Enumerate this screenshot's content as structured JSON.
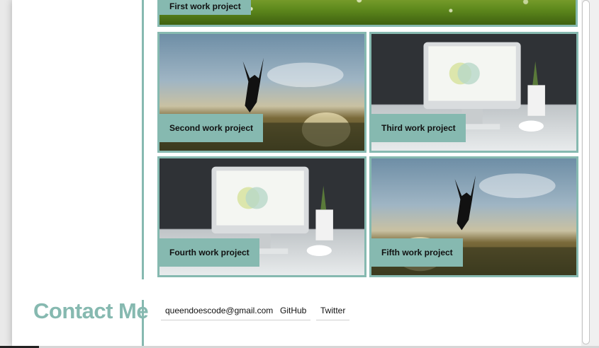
{
  "projects": [
    {
      "label": "First work project",
      "art": "meadow"
    },
    {
      "label": "Second work project",
      "art": "jumping-person"
    },
    {
      "label": "Third work project",
      "art": "desk-monitor"
    },
    {
      "label": "Fourth work project",
      "art": "desk-monitor"
    },
    {
      "label": "Fifth work project",
      "art": "jumping-person"
    }
  ],
  "contact": {
    "title": "Contact Me",
    "email": "queendoescode@gmail.com",
    "github": "GitHub",
    "twitter": "Twitter"
  },
  "colors": {
    "accent": "#86b9b0",
    "label_text": "#111111",
    "page_bg": "#ffffff"
  }
}
